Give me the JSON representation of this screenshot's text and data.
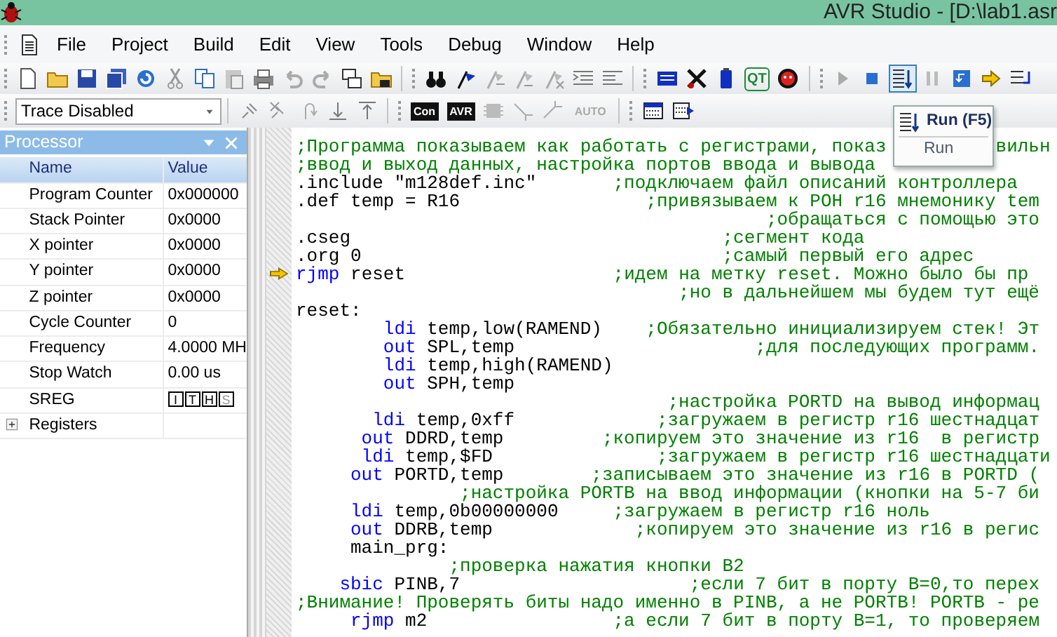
{
  "window": {
    "title": "AVR Studio - [D:\\lab1.asr"
  },
  "menu": [
    "File",
    "Project",
    "Build",
    "Edit",
    "View",
    "Tools",
    "Debug",
    "Window",
    "Help"
  ],
  "toolbar_1": {
    "labels": [
      {
        "text": "QT",
        "disabled": false
      }
    ]
  },
  "toolbar_2": {
    "trace": "Trace Disabled",
    "labels": [
      {
        "text": "Con",
        "disabled": false
      },
      {
        "text": "AVR",
        "disabled": false
      },
      {
        "text": "AUTO",
        "disabled": true
      }
    ]
  },
  "tooltip": {
    "title": "Run (F5)",
    "text": "Run"
  },
  "processor": {
    "title": "Processor",
    "columns": [
      "Name",
      "Value"
    ],
    "rows": [
      {
        "kind": "value",
        "name": "Program Counter",
        "value": "0x000000"
      },
      {
        "kind": "value",
        "name": "Stack Pointer",
        "value": "0x0000"
      },
      {
        "kind": "value",
        "name": "X pointer",
        "value": "0x0000"
      },
      {
        "kind": "value",
        "name": "Y pointer",
        "value": "0x0000"
      },
      {
        "kind": "value",
        "name": "Z pointer",
        "value": "0x0000"
      },
      {
        "kind": "value",
        "name": "Cycle Counter",
        "value": "0"
      },
      {
        "kind": "value",
        "name": "Frequency",
        "value": "4.0000 MH"
      },
      {
        "kind": "value",
        "name": "Stop Watch",
        "value": "0.00 us"
      },
      {
        "kind": "flags",
        "name": "SREG",
        "flags": [
          {
            "text": "I",
            "dimmed": false
          },
          {
            "text": "T",
            "dimmed": false
          },
          {
            "text": "H",
            "dimmed": false
          },
          {
            "text": "S",
            "dimmed": true
          }
        ]
      },
      {
        "kind": "group",
        "name": "Registers",
        "expanded": false
      }
    ]
  },
  "editor": {
    "lines": [
      {
        "current": false,
        "segments": [
          {
            "kind": "comment",
            "text": ";Программа показываем как работать с регистрами, показ"
          },
          {
            "kind": "comment_tail",
            "text": "вильн"
          }
        ]
      },
      {
        "current": false,
        "segments": [
          {
            "kind": "comment",
            "text": ";ввод и выход данных, настройка портов ввода и вывода"
          }
        ]
      },
      {
        "current": false,
        "segments": [
          {
            "kind": "code",
            "text": ".include \"m128def.inc\"       "
          },
          {
            "kind": "comment",
            "text": ";подключаем файл описаний контроллера"
          }
        ]
      },
      {
        "current": false,
        "segments": [
          {
            "kind": "code",
            "text": ".def temp = R16                 "
          },
          {
            "kind": "comment",
            "text": ";привязываем к РОН r16 мнемонику tem"
          }
        ]
      },
      {
        "current": false,
        "segments": [
          {
            "kind": "comment",
            "text": "                                           ;обращаться с помощью это"
          }
        ]
      },
      {
        "current": false,
        "segments": [
          {
            "kind": "code",
            "text": ".cseg                                  "
          },
          {
            "kind": "comment",
            "text": ";сегмент кода"
          }
        ]
      },
      {
        "current": false,
        "segments": [
          {
            "kind": "code",
            "text": ".org 0                                 "
          },
          {
            "kind": "comment",
            "text": ";самый первый его адрес"
          }
        ]
      },
      {
        "current": true,
        "segments": [
          {
            "kind": "keyword",
            "text": "rjmp"
          },
          {
            "kind": "code",
            "text": " reset                   "
          },
          {
            "kind": "comment",
            "text": ";идем на метку reset. Можно было бы пр"
          }
        ]
      },
      {
        "current": false,
        "segments": [
          {
            "kind": "comment",
            "text": "                                   ;но в дальнейшем мы будем тут ещё"
          }
        ]
      },
      {
        "current": false,
        "segments": [
          {
            "kind": "code",
            "text": "reset:"
          }
        ]
      },
      {
        "current": false,
        "segments": [
          {
            "kind": "keyword",
            "text": "        ldi"
          },
          {
            "kind": "code",
            "text": " temp,low(RAMEND)    "
          },
          {
            "kind": "comment",
            "text": ";Обязательно инициализируем стек! Эт"
          }
        ]
      },
      {
        "current": false,
        "segments": [
          {
            "kind": "keyword",
            "text": "        out"
          },
          {
            "kind": "code",
            "text": " SPL,temp                      "
          },
          {
            "kind": "comment",
            "text": ";для последующих программ."
          }
        ]
      },
      {
        "current": false,
        "segments": [
          {
            "kind": "keyword",
            "text": "        ldi"
          },
          {
            "kind": "code",
            "text": " temp,high(RAMEND)"
          }
        ]
      },
      {
        "current": false,
        "segments": [
          {
            "kind": "keyword",
            "text": "        out"
          },
          {
            "kind": "code",
            "text": " SPH,temp"
          }
        ]
      },
      {
        "current": false,
        "segments": [
          {
            "kind": "comment",
            "text": "                                  ;настройка PORTD на вывод информац"
          }
        ]
      },
      {
        "current": false,
        "segments": [
          {
            "kind": "keyword",
            "text": "       ldi"
          },
          {
            "kind": "code",
            "text": " temp,0xff             "
          },
          {
            "kind": "comment",
            "text": ";загружаем в регистр r16 шестнадцат"
          }
        ]
      },
      {
        "current": false,
        "segments": [
          {
            "kind": "keyword",
            "text": "      out"
          },
          {
            "kind": "code",
            "text": " DDRD,temp         "
          },
          {
            "kind": "comment",
            "text": ";копируем это значение из r16  в регистр"
          }
        ]
      },
      {
        "current": false,
        "segments": [
          {
            "kind": "keyword",
            "text": "      ldi"
          },
          {
            "kind": "code",
            "text": " temp,$FD               "
          },
          {
            "kind": "comment",
            "text": ";загружаем в регистр r16 шестнадцати"
          }
        ]
      },
      {
        "current": false,
        "segments": [
          {
            "kind": "keyword",
            "text": "     out"
          },
          {
            "kind": "code",
            "text": " PORTD,temp        "
          },
          {
            "kind": "comment",
            "text": ";записываем это значение из r16 в PORTD ("
          }
        ]
      },
      {
        "current": false,
        "segments": [
          {
            "kind": "comment",
            "text": "               ;настройка PORTB на ввод информации (кнопки на 5-7 би"
          }
        ]
      },
      {
        "current": false,
        "segments": [
          {
            "kind": "keyword",
            "text": "     ldi"
          },
          {
            "kind": "code",
            "text": " temp,0b00000000     "
          },
          {
            "kind": "comment",
            "text": ";загружаем в регистр r16 ноль"
          }
        ]
      },
      {
        "current": false,
        "segments": [
          {
            "kind": "keyword",
            "text": "     out"
          },
          {
            "kind": "code",
            "text": " DDRB,temp             "
          },
          {
            "kind": "comment",
            "text": ";копируем это значение из r16 в регис"
          }
        ]
      },
      {
        "current": false,
        "segments": [
          {
            "kind": "code",
            "text": "     main_prg:"
          }
        ]
      },
      {
        "current": false,
        "segments": [
          {
            "kind": "comment",
            "text": "              ;проверка нажатия кнопки B2"
          }
        ]
      },
      {
        "current": false,
        "segments": [
          {
            "kind": "keyword",
            "text": "    sbic"
          },
          {
            "kind": "code",
            "text": " PINB,7                     "
          },
          {
            "kind": "comment",
            "text": ";если 7 бит в порту B=0,то перех"
          }
        ]
      },
      {
        "current": false,
        "segments": [
          {
            "kind": "comment",
            "text": ";Внимание! Проверять биты надо именно в PINB, а не PORTB! PORTB - ре"
          }
        ]
      },
      {
        "current": false,
        "segments": [
          {
            "kind": "keyword",
            "text": "     rjmp"
          },
          {
            "kind": "code",
            "text": " m2                 "
          },
          {
            "kind": "comment",
            "text": ";а если 7 бит в порту B=1, то проверяем"
          }
        ]
      }
    ]
  }
}
